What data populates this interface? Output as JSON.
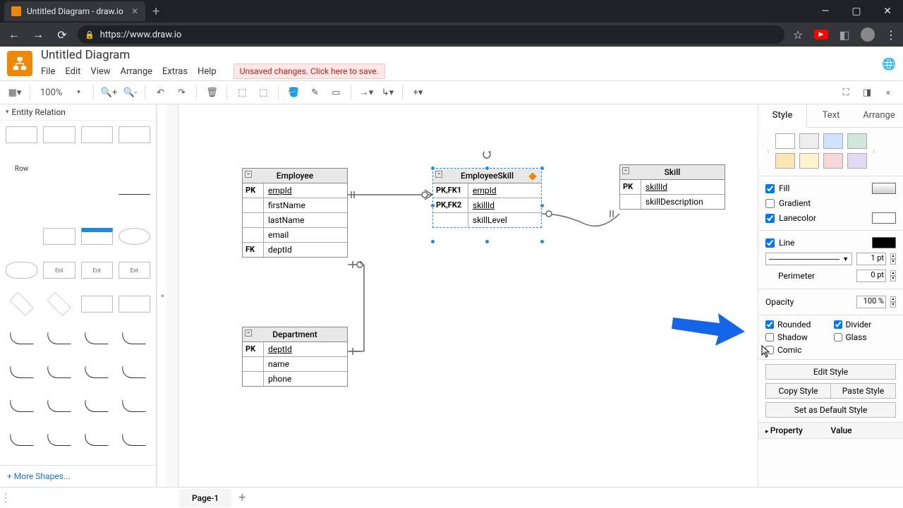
{
  "browser": {
    "tab_title": "Untitled Diagram - draw.io",
    "url": "https://www.draw.io"
  },
  "app": {
    "doc_title": "Untitled Diagram",
    "menus": [
      "File",
      "Edit",
      "View",
      "Arrange",
      "Extras",
      "Help"
    ],
    "unsaved": "Unsaved changes. Click here to save."
  },
  "toolbar": {
    "zoom": "100%"
  },
  "sidebar": {
    "section": "Entity Relation",
    "row_label": "Row",
    "more": "+ More Shapes..."
  },
  "canvas": {
    "tables": {
      "employee": {
        "title": "Employee",
        "rows": [
          {
            "key": "PK",
            "field": "empId",
            "u": true
          },
          {
            "key": "",
            "field": "firstName"
          },
          {
            "key": "",
            "field": "lastName"
          },
          {
            "key": "",
            "field": "email"
          },
          {
            "key": "FK",
            "field": "deptId"
          }
        ]
      },
      "employeeSkill": {
        "title": "EmployeeSkill",
        "rows": [
          {
            "key": "PK,FK1",
            "field": "empId",
            "u": true
          },
          {
            "key": "PK,FK2",
            "field": "skillId",
            "u": true
          },
          {
            "key": "",
            "field": "skillLevel"
          }
        ]
      },
      "skill": {
        "title": "Skill",
        "rows": [
          {
            "key": "PK",
            "field": "skillId",
            "u": true
          },
          {
            "key": "",
            "field": "skillDescription"
          }
        ]
      },
      "department": {
        "title": "Department",
        "rows": [
          {
            "key": "PK",
            "field": "deptId",
            "u": true
          },
          {
            "key": "",
            "field": "name"
          },
          {
            "key": "",
            "field": "phone"
          }
        ]
      }
    }
  },
  "rpanel": {
    "tabs": [
      "Style",
      "Text",
      "Arrange"
    ],
    "fill": "Fill",
    "gradient": "Gradient",
    "lanecolor": "Lanecolor",
    "line": "Line",
    "line_pt": "1 pt",
    "perimeter": "Perimeter",
    "perimeter_pt": "0 pt",
    "opacity": "Opacity",
    "opacity_val": "100 %",
    "rounded": "Rounded",
    "divider": "Divider",
    "shadow": "Shadow",
    "glass": "Glass",
    "comic": "Comic",
    "edit_style": "Edit Style",
    "copy_style": "Copy Style",
    "paste_style": "Paste Style",
    "set_default": "Set as Default Style",
    "property": "Property",
    "value": "Value"
  },
  "footer": {
    "page": "Page-1"
  }
}
